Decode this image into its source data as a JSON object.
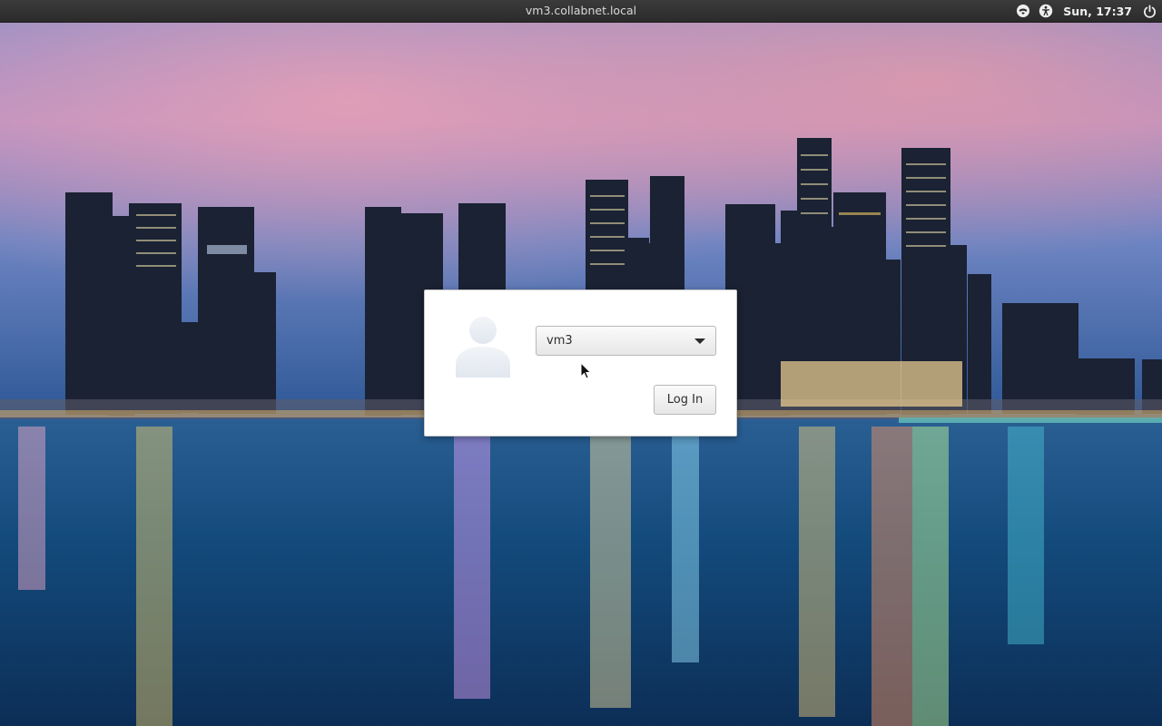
{
  "top_panel": {
    "hostname": "vm3.collabnet.local",
    "clock": "Sun, 17:37",
    "icons": [
      "network-icon",
      "accessibility-icon",
      "power-icon"
    ]
  },
  "login": {
    "selected_user": "vm3",
    "login_label": "Log In"
  },
  "colors": {
    "panel_background": "#2f2f2f",
    "dialog_background": "#ffffff",
    "sky_top": "#7a86c4",
    "sky_pink": "#d98fb6",
    "water": "#0f3c6b"
  }
}
